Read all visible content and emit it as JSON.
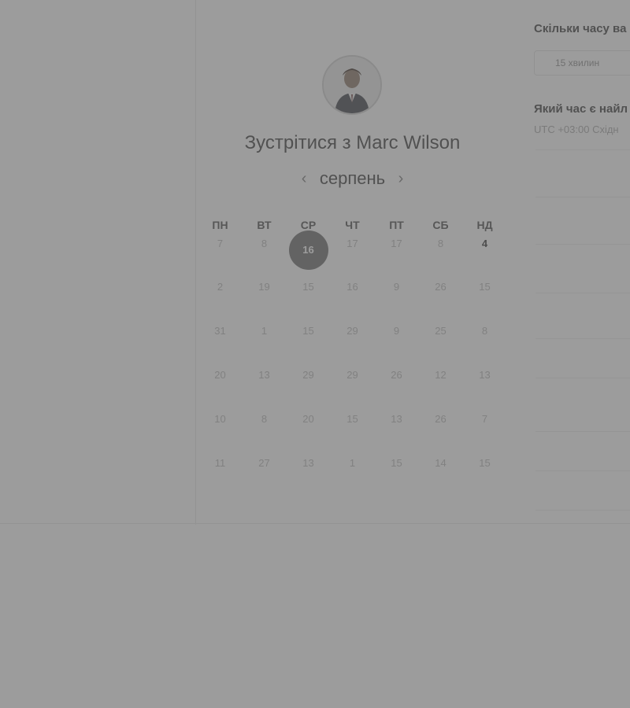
{
  "host": {
    "title": "Зустрітися з Marc Wilson",
    "avatar_icon": "person-portrait-icon"
  },
  "calendar": {
    "month": "серпень",
    "prev_icon": "chevron-left-icon",
    "next_icon": "chevron-right-icon",
    "weekdays": [
      "ПН",
      "ВТ",
      "СР",
      "ЧТ",
      "ПТ",
      "СБ",
      "НД"
    ],
    "selected_day": "16",
    "rows": [
      [
        "7",
        "8",
        "16",
        "17",
        "17",
        "8",
        "4"
      ],
      [
        "2",
        "19",
        "15",
        "16",
        "9",
        "26",
        "15"
      ],
      [
        "31",
        "1",
        "15",
        "29",
        "9",
        "25",
        "8"
      ],
      [
        "20",
        "13",
        "29",
        "29",
        "26",
        "12",
        "13"
      ],
      [
        "10",
        "8",
        "20",
        "15",
        "13",
        "26",
        "7"
      ],
      [
        "11",
        "27",
        "13",
        "1",
        "15",
        "14",
        "15"
      ]
    ]
  },
  "booking": {
    "duration_question": "Скільки часу ва",
    "duration_value": "15 хвилин",
    "time_question": "Який час є найл",
    "timezone": "UTC +03:00 Східн"
  },
  "colors": {
    "overlay": "#606060",
    "selected_circle": "#6b6b6b",
    "background": "#ffffff"
  }
}
